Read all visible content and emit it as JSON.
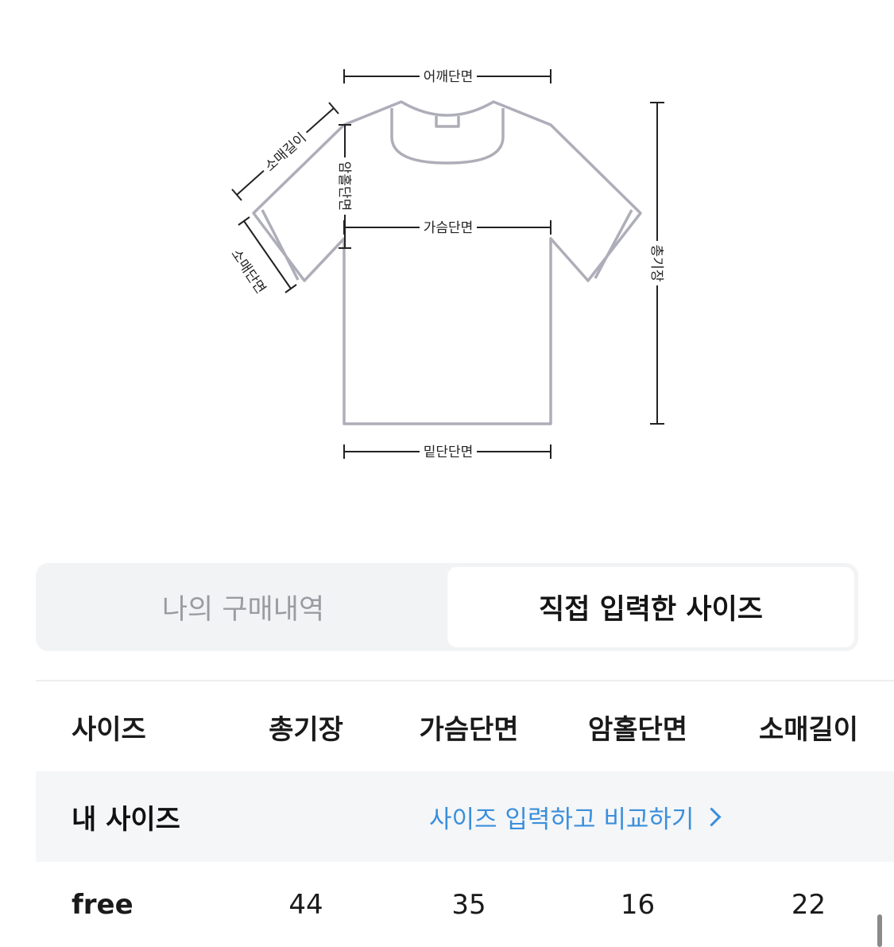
{
  "diagram": {
    "labels": {
      "shoulder": "어깨단면",
      "sleeve_length": "소매길이",
      "armhole": "암홀단면",
      "chest": "가슴단면",
      "sleeve_opening": "소매단면",
      "total_length": "총기장",
      "hem": "밑단단면"
    },
    "colors": {
      "garment_outline": "#aeaeb9",
      "dimension_line": "#222222"
    }
  },
  "tabs": {
    "purchase_history": "나의 구매내역",
    "entered_size": "직접 입력한 사이즈",
    "active": "entered_size"
  },
  "table": {
    "headers": [
      "사이즈",
      "총기장",
      "가슴단면",
      "암홀단면",
      "소매길이"
    ],
    "my_size": {
      "label": "내 사이즈",
      "link_text": "사이즈 입력하고 비교하기"
    },
    "rows": [
      {
        "size": "free",
        "values": [
          "44",
          "35",
          "16",
          "22"
        ]
      }
    ],
    "colors": {
      "link": "#3a8fdc",
      "my_size_row_bg": "#f5f6f8"
    }
  }
}
